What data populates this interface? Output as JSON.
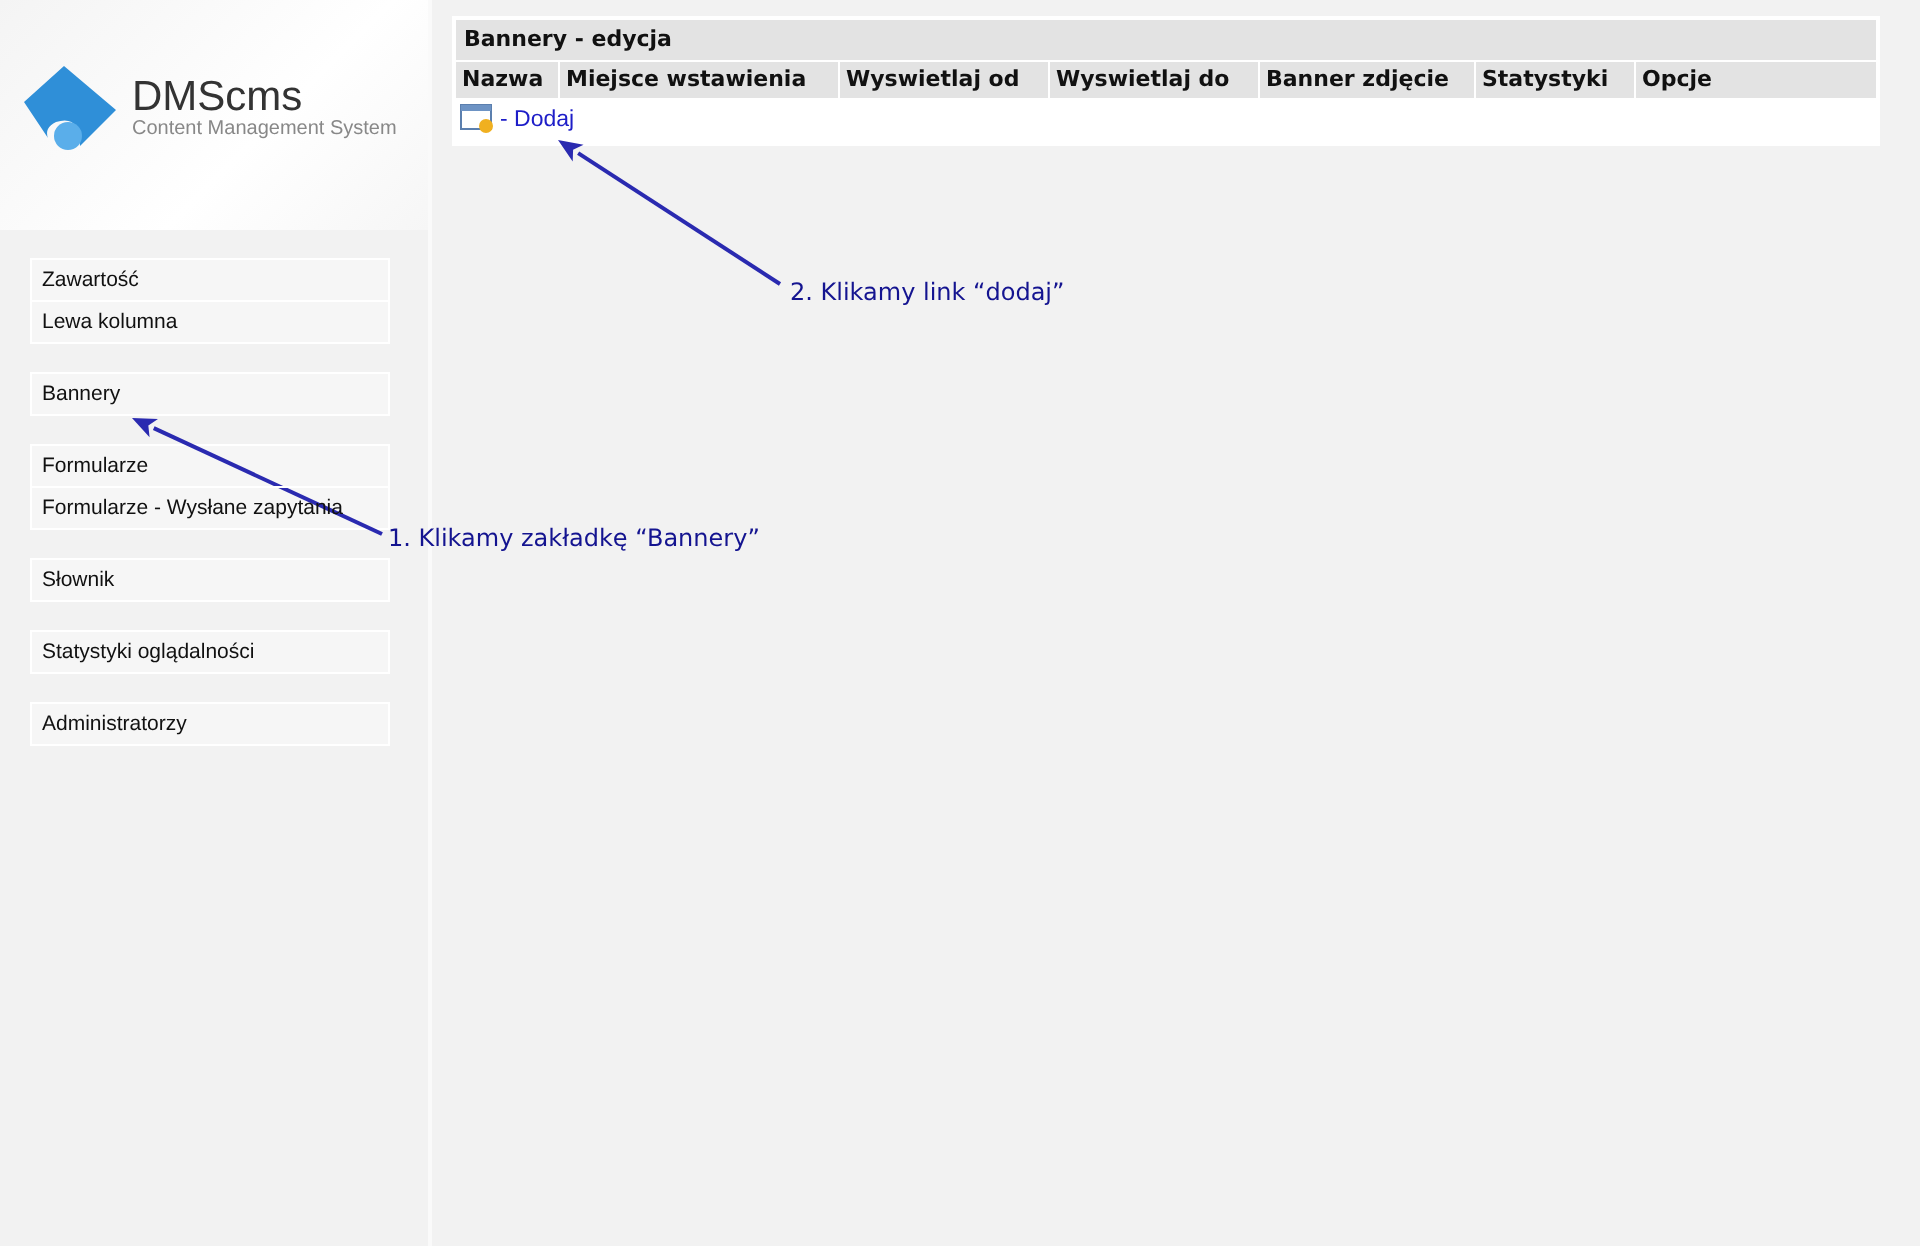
{
  "logo": {
    "name": "DMScms",
    "tagline": "Content Management System"
  },
  "sidebar": {
    "groups": [
      {
        "items": [
          "Zawartość",
          "Lewa kolumna"
        ]
      },
      {
        "items": [
          "Bannery"
        ]
      },
      {
        "items": [
          "Formularze",
          "Formularze - Wysłane zapytania"
        ]
      },
      {
        "items": [
          "Słownik"
        ]
      },
      {
        "items": [
          "Statystyki oglądalności"
        ]
      },
      {
        "items": [
          "Administratorzy"
        ]
      }
    ]
  },
  "panel": {
    "title": "Bannery - edycja",
    "columns": [
      "Nazwa",
      "Miejsce wstawienia",
      "Wyswietlaj od",
      "Wyswietlaj do",
      "Banner zdjęcie",
      "Statystyki",
      "Opcje"
    ],
    "add_link": "- Dodaj"
  },
  "annotations": [
    {
      "text": "1. Klikamy zakładkę “Bannery”"
    },
    {
      "text": "2. Klikamy link “dodaj”"
    }
  ]
}
